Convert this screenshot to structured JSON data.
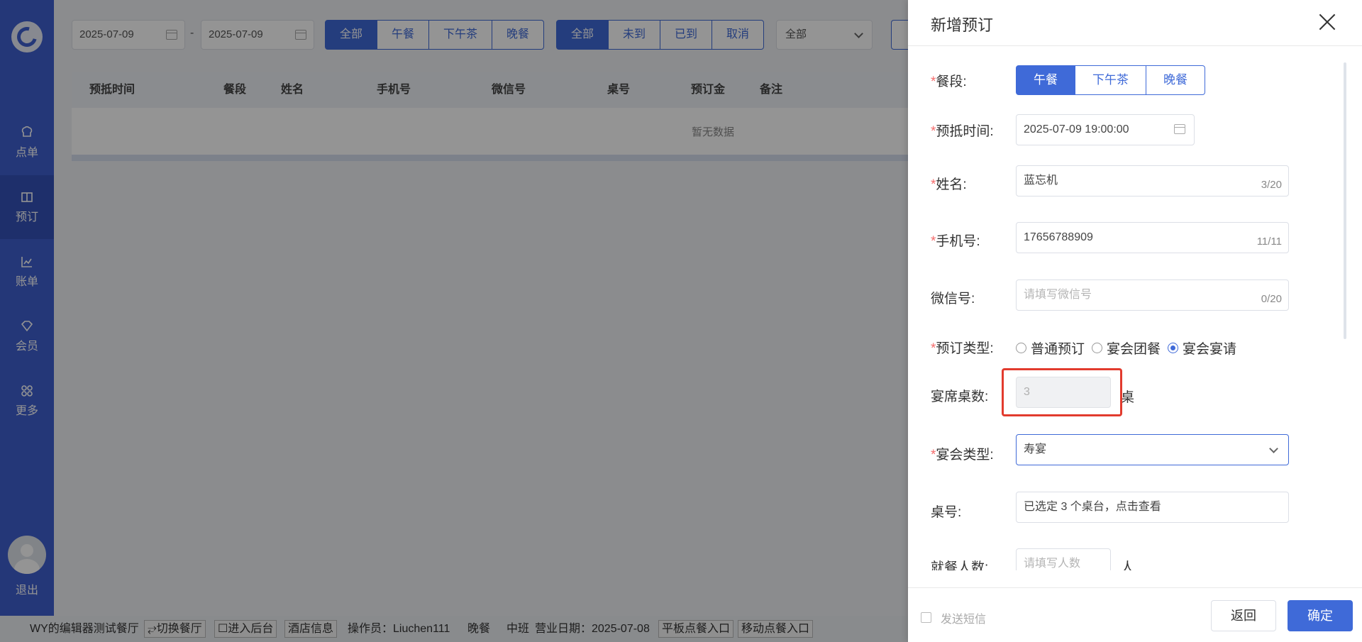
{
  "sidebar": {
    "items": [
      {
        "label": "点单",
        "icon": "chef-hat-icon"
      },
      {
        "label": "预订",
        "icon": "book-icon"
      },
      {
        "label": "账单",
        "icon": "chart-icon"
      },
      {
        "label": "会员",
        "icon": "diamond-icon"
      },
      {
        "label": "更多",
        "icon": "grid-icon"
      }
    ],
    "logout": "退出"
  },
  "filters": {
    "date_from": "2025-07-09",
    "date_to": "2025-07-09",
    "dash": "-",
    "meal_buttons": [
      "全部",
      "午餐",
      "下午茶",
      "晚餐"
    ],
    "status_buttons": [
      "全部",
      "未到",
      "已到",
      "取消"
    ],
    "select_value": "全部"
  },
  "table": {
    "columns": [
      "预抵时间",
      "餐段",
      "姓名",
      "手机号",
      "微信号",
      "桌号",
      "预订金",
      "备注"
    ],
    "empty_text": "暂无数据"
  },
  "statusbar": {
    "restaurant": "WY的编辑器测试餐厅",
    "switch": "⥂切换餐厅",
    "backend": "☐进入后台",
    "hotel_info": "酒店信息",
    "operator": "操作员：Liuchen111",
    "meal": "晚餐",
    "shift": "中班",
    "business_date": "营业日期：2025-07-08",
    "tablet_entry": "平板点餐入口",
    "mobile_entry": "移动点餐入口"
  },
  "drawer": {
    "title": "新增预订",
    "meal_label": "餐段:",
    "meal_options": [
      "午餐",
      "下午茶",
      "晚餐"
    ],
    "time_label": "预抵时间:",
    "time_value": "2025-07-09 19:00:00",
    "name_label": "姓名:",
    "name_value": "蓝忘机",
    "name_count": "3/20",
    "phone_label": "手机号:",
    "phone_value": "17656788909",
    "phone_count": "11/11",
    "wechat_label": "微信号:",
    "wechat_placeholder": "请填写微信号",
    "wechat_count": "0/20",
    "type_label": "预订类型:",
    "type_options": [
      "普通预订",
      "宴会团餐",
      "宴会宴请"
    ],
    "tables_label": "宴席桌数:",
    "tables_value": "3",
    "tables_unit": "桌",
    "banquet_label": "宴会类型:",
    "banquet_value": "寿宴",
    "table_no_label": "桌号:",
    "table_no_value": "已选定 3 个桌台，点击查看",
    "people_label": "就餐人数:",
    "people_placeholder": "请填写人数",
    "people_unit": "人",
    "sms_label": "发送短信",
    "back_button": "返回",
    "confirm_button": "确定"
  }
}
